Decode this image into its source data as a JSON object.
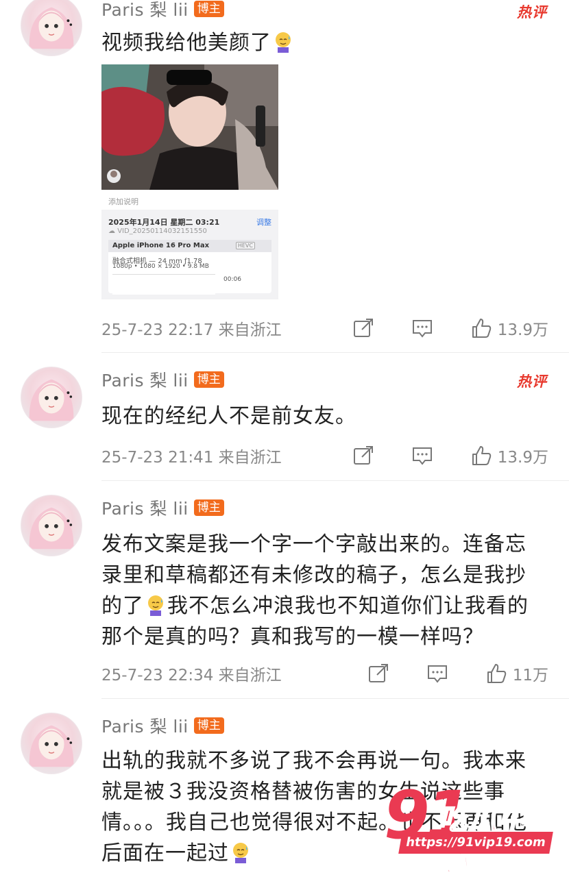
{
  "comments": [
    {
      "username": "Paris 梨 lii",
      "badge": "博主",
      "hot_label": "热评",
      "text": "视频我给他美颜了",
      "emoji": "sweat-smile-emoji",
      "timestamp": "25-7-23 22:17",
      "location": "来自浙江",
      "likes": "13.9万",
      "media": {
        "caption_hint": "添加说明",
        "video_info": {
          "date": "2025年1月14日 星期二 03:21",
          "adjust": "调整",
          "filename": "VID_20250114032151550",
          "device": "Apple iPhone 16 Pro Max",
          "codec": "HEVC",
          "lens": "融合式相机 — 24 mm ƒ1.78",
          "specs": "1080p • 1080 × 1920 • 9.8 MB",
          "duration": "00:06"
        }
      }
    },
    {
      "username": "Paris 梨 lii",
      "badge": "博主",
      "hot_label": "热评",
      "text": "现在的经纪人不是前女友。",
      "timestamp": "25-7-23 21:41",
      "location": "来自浙江",
      "likes": "13.9万"
    },
    {
      "username": "Paris 梨 lii",
      "badge": "博主",
      "text_part1": "发布文案是我一个字一个字敲出来的。连备忘录里和草稿都还有未修改的稿子，怎么是我抄的了",
      "text_part2": "我不怎么冲浪我也不知道你们让我看的那个是真的吗？真和我写的一模一样吗？",
      "emoji": "sweat-smile-emoji",
      "timestamp": "25-7-23 22:34",
      "location": "来自浙江",
      "likes": "11万"
    },
    {
      "username": "Paris 梨 lii",
      "badge": "博主",
      "text": "出轨的我就不多说了我不会再说一句。我本来就是被３我没资格替被伤害的女生说这些事情。。。我自己也觉得很对不起。也不想再和他后面在一起过",
      "emoji": "sweat-smile-emoji"
    }
  ],
  "icons": {
    "repost": "repost-icon",
    "comment": "comment-icon",
    "like": "like-icon"
  },
  "watermark": {
    "number": "91",
    "brand": "吃瓜中心",
    "url": "https://91vip19.com"
  },
  "colors": {
    "badge": "#f26b1d",
    "hot": "#e8392e",
    "watermark": "#ea3a52",
    "meta_text": "#888888"
  }
}
